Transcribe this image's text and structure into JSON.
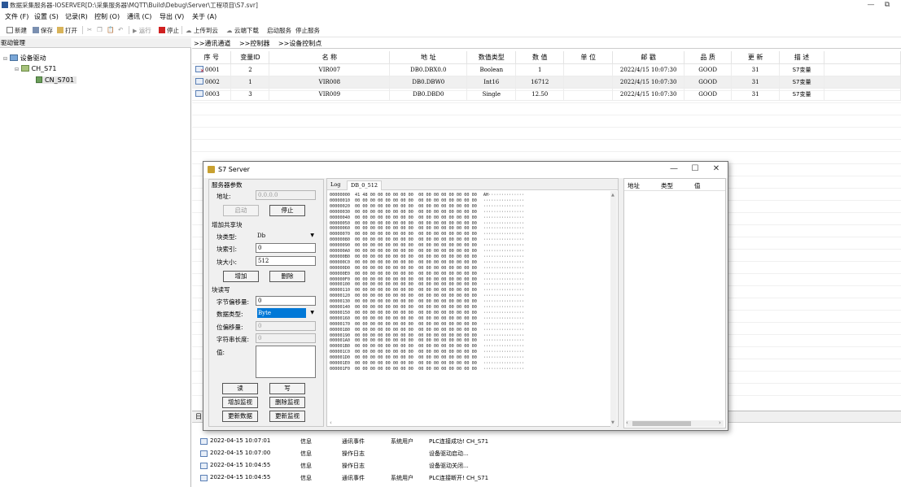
{
  "window": {
    "title": "数据采集服务器-IOSERVER[D:\\采集服务器\\MQTT\\Build\\Debug\\Server\\工程项目\\S7.svr]",
    "minimize": "—",
    "restore": "⧉"
  },
  "menu": [
    "文件 (F)",
    "设置 (S)",
    "记录(R)",
    "控制 (O)",
    "通讯 (C)",
    "导出 (V)",
    "关于 (A)"
  ],
  "toolbar": {
    "new": "新建",
    "save": "保存",
    "open": "打开",
    "run": "运行",
    "stop": "停止",
    "upload": "上传到云",
    "download": "云端下载",
    "start_service": "启动服务",
    "stop_service": "停止服务"
  },
  "tree": {
    "header": "驱动管理",
    "root": "设备驱动",
    "channel": "CH_S71",
    "device": "CN_S701"
  },
  "breadcrumb": [
    ">>通讯通道",
    ">>控制器",
    ">>设备控制点"
  ],
  "grid": {
    "columns": [
      "序 号",
      "变量ID",
      "名 称",
      "地 址",
      "数值类型",
      "数 值",
      "单 位",
      "邮 戳",
      "品 质",
      "更 新",
      "描 述"
    ],
    "rows": [
      [
        "0001",
        "2",
        "VIR007",
        "DB0.DBX0.0",
        "Boolean",
        "1",
        "",
        "2022/4/15 10:07:30",
        "GOOD",
        "31",
        "S7变量"
      ],
      [
        "0002",
        "1",
        "VIR008",
        "DB0.DBW0",
        "Int16",
        "16712",
        "",
        "2022/4/15 10:07:30",
        "GOOD",
        "31",
        "S7变量"
      ],
      [
        "0003",
        "3",
        "VIR009",
        "DB0.DBD0",
        "Single",
        "12.50",
        "",
        "2022/4/15 10:07:30",
        "GOOD",
        "31",
        "S7变量"
      ]
    ]
  },
  "log": {
    "header": "日",
    "rows": [
      [
        "2022-04-15 10:07:01",
        "信息",
        "通讯事件",
        "系统用户",
        "PLC连接成功! CH_S71"
      ],
      [
        "2022-04-15 10:07:00",
        "信息",
        "操作日志",
        "",
        "设备驱动启动..."
      ],
      [
        "2022-04-15 10:04:55",
        "信息",
        "操作日志",
        "",
        "设备驱动关闭..."
      ],
      [
        "2022-04-15 10:04:55",
        "信息",
        "通讯事件",
        "系统用户",
        "PLC连接断开! CH_S71"
      ]
    ]
  },
  "dialog": {
    "title": "S7 Server",
    "close": "✕",
    "maximize": "☐",
    "minimize": "—",
    "server_group": "服务器参数",
    "address_label": "地址:",
    "address_value": "0.0.0.0",
    "start_btn": "启动",
    "stop_btn": "停止",
    "share_group": "增加共享块",
    "block_type_label": "块类型:",
    "block_type_value": "Db",
    "block_index_label": "块索引:",
    "block_index_value": "0",
    "block_size_label": "块大小:",
    "block_size_value": "512",
    "add_btn": "增加",
    "delete_btn": "删除",
    "rw_group": "块读写",
    "byte_offset_label": "字节偏移量:",
    "byte_offset_value": "0",
    "data_type_label": "数据类型:",
    "data_type_value": "Byte",
    "bit_offset_label": "位偏移量:",
    "bit_offset_value": "0",
    "str_len_label": "字符串长度:",
    "str_len_value": "0",
    "value_label": "值:",
    "read_btn": "读",
    "write_btn": "写",
    "add_watch_btn": "增加监视",
    "del_watch_btn": "删除监视",
    "update_data_btn": "更新数据",
    "update_watch_btn": "更新监视",
    "tabs": [
      "Log",
      "DB_0_512"
    ],
    "hex_addresses": [
      "00000000",
      "00000010",
      "00000020",
      "00000030",
      "00000040",
      "00000050",
      "00000060",
      "00000070",
      "00000080",
      "00000090",
      "000000A0",
      "000000B0",
      "000000C0",
      "000000D0",
      "000000E0",
      "000000F0",
      "00000100",
      "00000110",
      "00000120",
      "00000130",
      "00000140",
      "00000150",
      "00000160",
      "00000170",
      "00000180",
      "00000190",
      "000001A0",
      "000001B0",
      "000001C0",
      "000001D0",
      "000001E0",
      "000001F0"
    ],
    "hex_first_row": "41 48 00 00 00 00 00 00  00 00 00 00 00 00 00 00",
    "hex_zero_row": "00 00 00 00 00 00 00 00  00 00 00 00 00 00 00 00",
    "ascii_first_row": "AH··············",
    "ascii_zero_row": "················",
    "watch_columns": [
      "地址",
      "类型",
      "值"
    ]
  }
}
